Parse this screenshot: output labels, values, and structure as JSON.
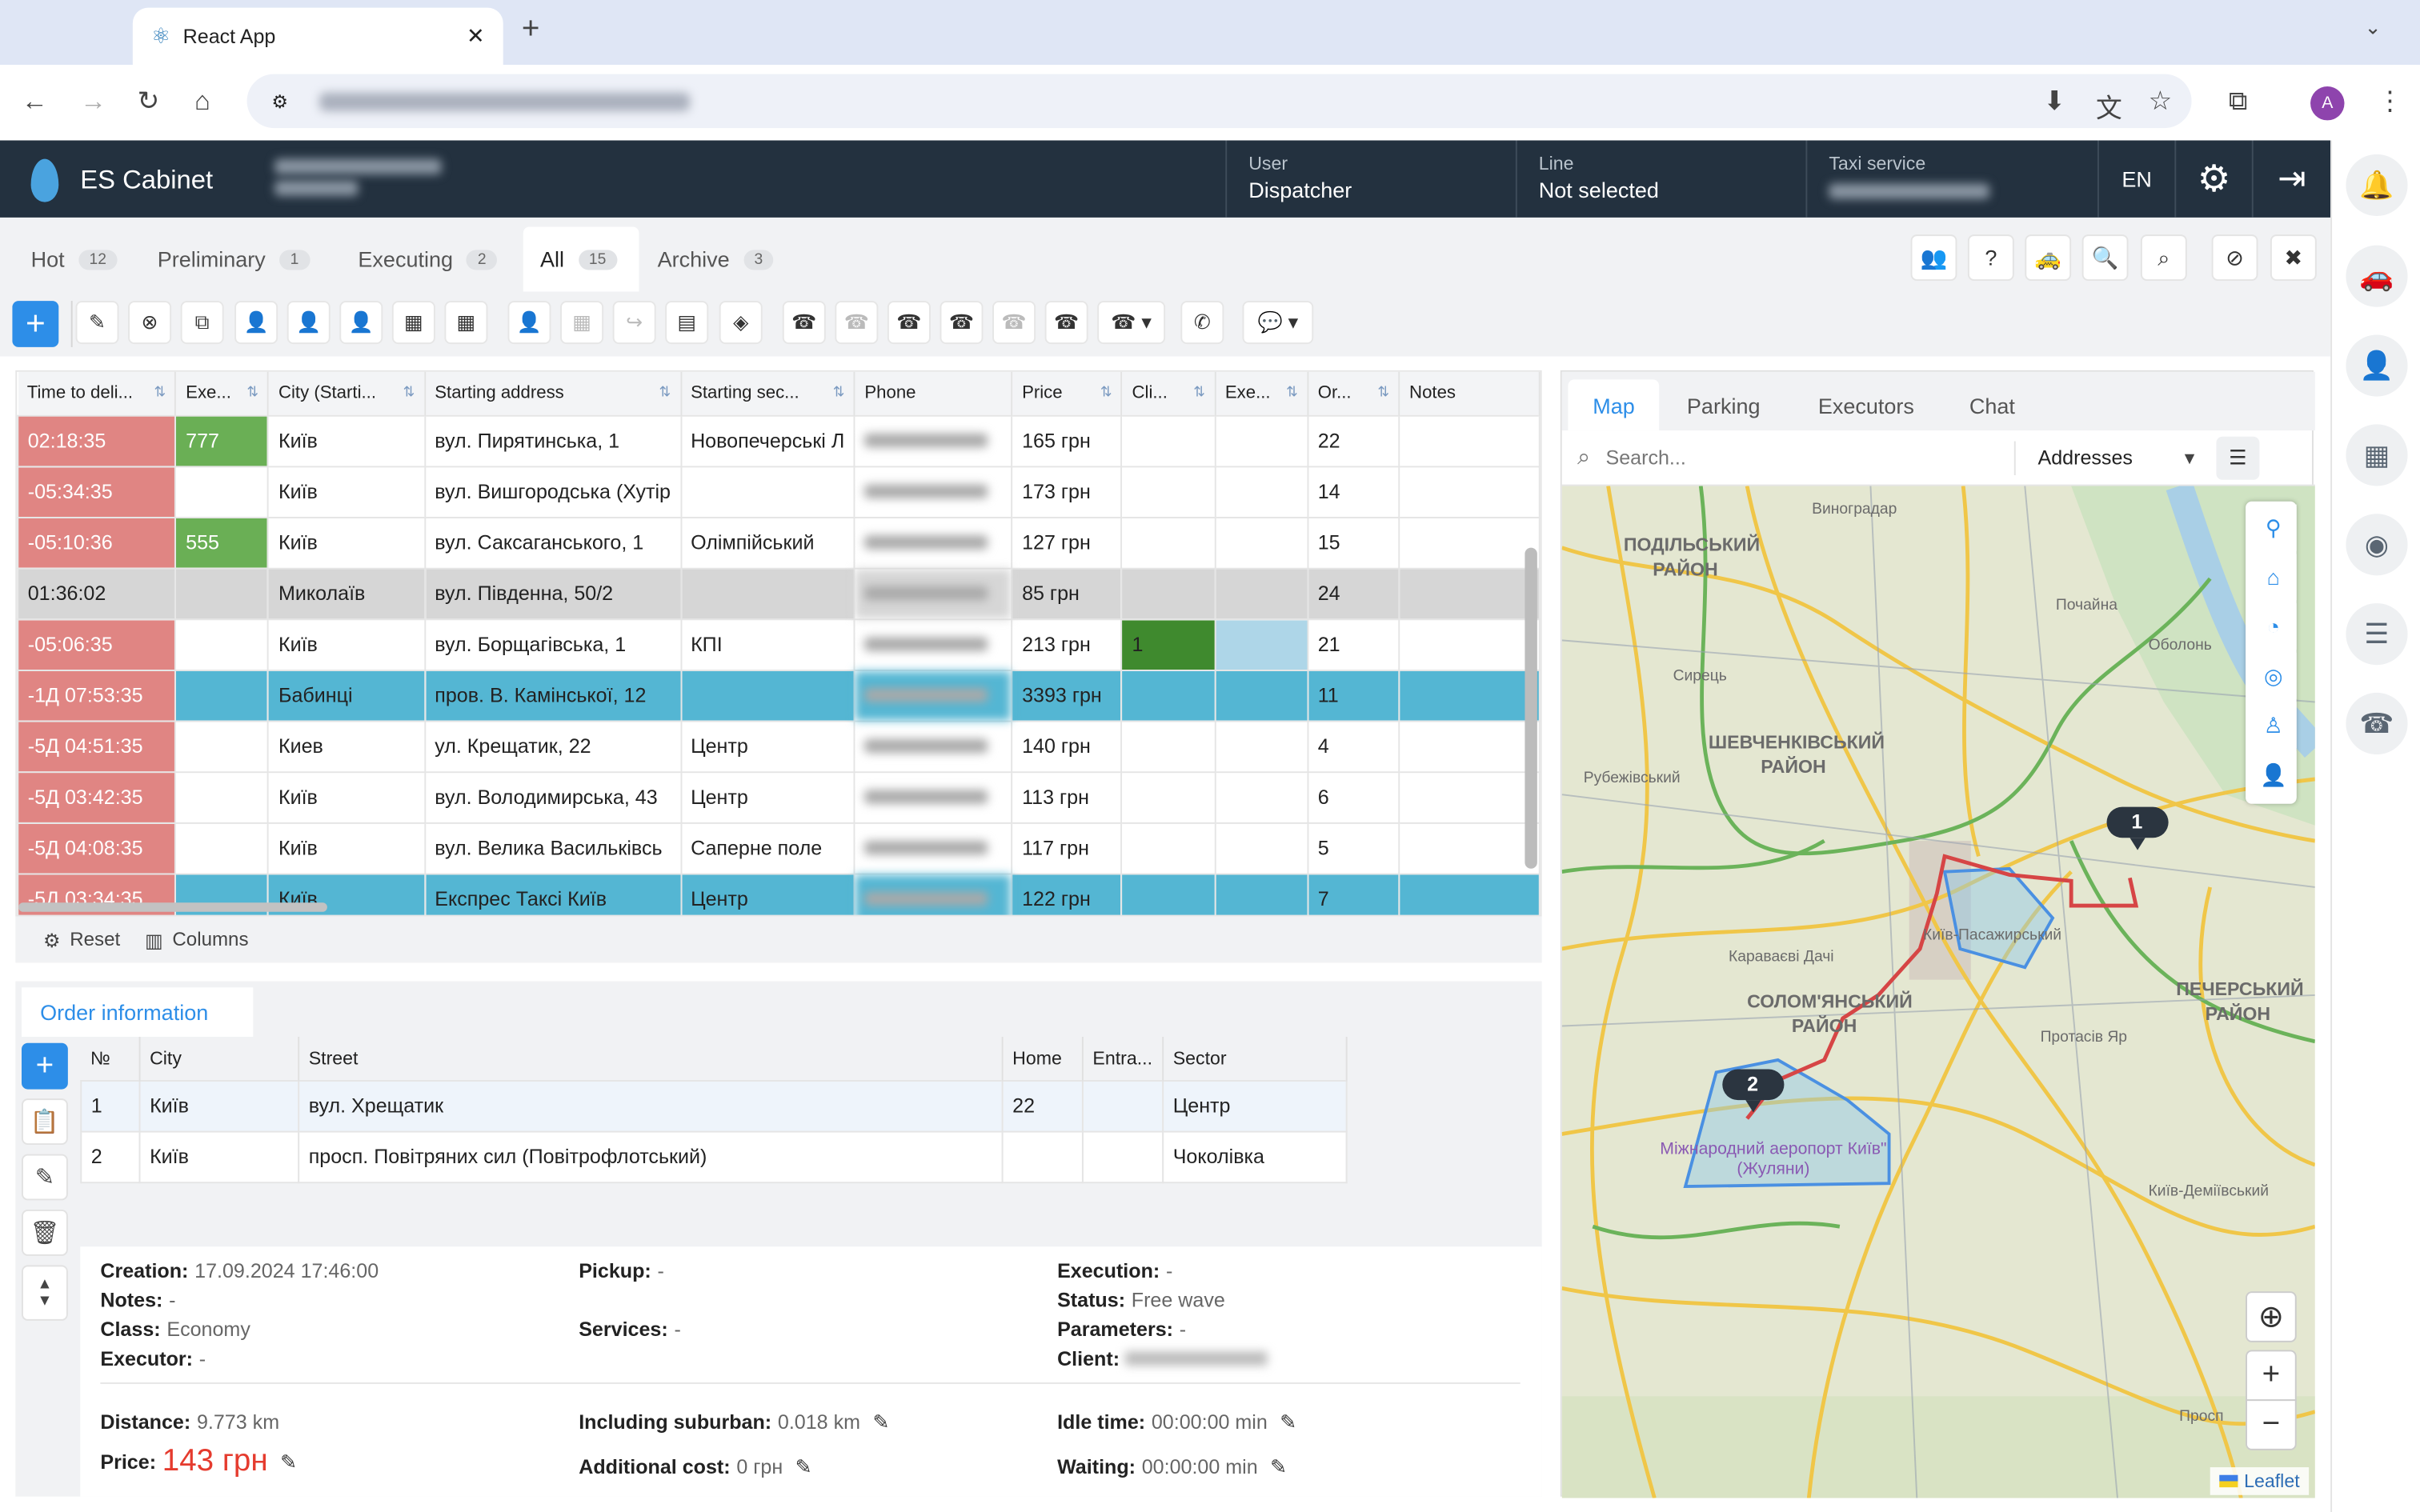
{
  "browser": {
    "tab_title": "React App",
    "new_tab": "+",
    "tab_menu": "⌄",
    "avatar": "A"
  },
  "app": {
    "brand": "ES Cabinet",
    "user": {
      "label": "User",
      "value": "Dispatcher"
    },
    "line": {
      "label": "Line",
      "value": "Not selected"
    },
    "taxi": {
      "label": "Taxi service"
    },
    "lang": "EN"
  },
  "tabs": [
    {
      "label": "Hot",
      "count": "12"
    },
    {
      "label": "Preliminary",
      "count": "1"
    },
    {
      "label": "Executing",
      "count": "2"
    },
    {
      "label": "All",
      "count": "15"
    },
    {
      "label": "Archive",
      "count": "3"
    }
  ],
  "table": {
    "headers": [
      "Time to deli...",
      "Exe...",
      "City (Starti...",
      "Starting address",
      "Starting sec...",
      "Phone",
      "Price",
      "Cli...",
      "Exe...",
      "Or...",
      "Notes"
    ],
    "rows": [
      {
        "time": "02:18:35",
        "exe": "777",
        "city": "Київ",
        "addr": "вул. Пирятинська, 1",
        "sector": "Новопечерські Л",
        "price": "165 грн",
        "cli": "",
        "exe2": "",
        "order": "22",
        "style": ""
      },
      {
        "time": "-05:34:35",
        "exe": "",
        "city": "Київ",
        "addr": "вул. Вишгородська (Хутір",
        "sector": "",
        "price": "173 грн",
        "cli": "",
        "exe2": "",
        "order": "14",
        "style": ""
      },
      {
        "time": "-05:10:36",
        "exe": "555",
        "city": "Київ",
        "addr": "вул. Саксаганського, 1",
        "sector": "Олімпійський",
        "price": "127 грн",
        "cli": "",
        "exe2": "",
        "order": "15",
        "style": ""
      },
      {
        "time": "01:36:02",
        "exe": "",
        "city": "Миколаїв",
        "addr": "вул. Південна, 50/2",
        "sector": "",
        "price": "85 грн",
        "cli": "",
        "exe2": "",
        "order": "24",
        "style": "gray"
      },
      {
        "time": "-05:06:35",
        "exe": "",
        "city": "Київ",
        "addr": "вул. Борщагівська, 1",
        "sector": "КПІ",
        "price": "213 грн",
        "cli": "1",
        "exe2": "",
        "order": "21",
        "style": ""
      },
      {
        "time": "-1Д 07:53:35",
        "exe": "",
        "city": "Бабинці",
        "addr": "пров. В. Камінської, 12",
        "sector": "",
        "price": "3393 грн",
        "cli": "",
        "exe2": "",
        "order": "11",
        "style": "blue"
      },
      {
        "time": "-5Д 04:51:35",
        "exe": "",
        "city": "Киев",
        "addr": "ул. Крещатик, 22",
        "sector": "Центр",
        "price": "140 грн",
        "cli": "",
        "exe2": "",
        "order": "4",
        "style": ""
      },
      {
        "time": "-5Д 03:42:35",
        "exe": "",
        "city": "Київ",
        "addr": "вул. Володимирська, 43",
        "sector": "Центр",
        "price": "113 грн",
        "cli": "",
        "exe2": "",
        "order": "6",
        "style": ""
      },
      {
        "time": "-5Д 04:08:35",
        "exe": "",
        "city": "Київ",
        "addr": "вул. Велика Васильківсь",
        "sector": "Саперне поле",
        "price": "117 грн",
        "cli": "",
        "exe2": "",
        "order": "5",
        "style": ""
      },
      {
        "time": "-5Д 03:34:35",
        "exe": "",
        "city": "Київ",
        "addr": "Експрес Таксі Київ",
        "sector": "Центр",
        "price": "122 грн",
        "cli": "",
        "exe2": "",
        "order": "7",
        "style": "blue"
      }
    ],
    "reset": "Reset",
    "columns": "Columns"
  },
  "order_info": {
    "tab": "Order information",
    "headers": [
      "№",
      "City",
      "Street",
      "Home",
      "Entra...",
      "Sector"
    ],
    "rows": [
      {
        "n": "1",
        "city": "Київ",
        "street": "вул. Хрещатик",
        "home": "22",
        "entr": "",
        "sector": "Центр"
      },
      {
        "n": "2",
        "city": "Київ",
        "street": "просп. Повітряних сил (Повітрофлотський)",
        "home": "",
        "entr": "",
        "sector": "Чоколівка"
      }
    ],
    "creation": {
      "k": "Creation:",
      "v": "17.09.2024 17:46:00"
    },
    "notes": {
      "k": "Notes:",
      "v": "-"
    },
    "class": {
      "k": "Class:",
      "v": "Economy"
    },
    "executor": {
      "k": "Executor:",
      "v": "-"
    },
    "pickup": {
      "k": "Pickup:",
      "v": "-"
    },
    "services": {
      "k": "Services:",
      "v": "-"
    },
    "execution": {
      "k": "Execution:",
      "v": "-"
    },
    "status": {
      "k": "Status:",
      "v": "Free wave"
    },
    "parameters": {
      "k": "Parameters:",
      "v": "-"
    },
    "client": {
      "k": "Client:"
    },
    "distance": {
      "k": "Distance:",
      "v": "9.773 km"
    },
    "suburban": {
      "k": "Including suburban:",
      "v": "0.018 km"
    },
    "idle": {
      "k": "Idle time:",
      "v": "00:00:00 min"
    },
    "price": {
      "k": "Price:",
      "v": "143 грн"
    },
    "additional": {
      "k": "Additional cost:",
      "v": "0 грн"
    },
    "waiting": {
      "k": "Waiting:",
      "v": "00:00:00 min"
    }
  },
  "map": {
    "tabs": [
      "Map",
      "Parking",
      "Executors",
      "Chat"
    ],
    "search_placeholder": "Search...",
    "addresses": "Addresses",
    "labels": [
      "ПОДІЛЬСЬКИЙ РАЙОН",
      "ШЕВЧЕНКІВСЬКИЙ РАЙОН",
      "СОЛОМ'ЯНСЬКИЙ РАЙОН",
      "ПЕЧЕРСЬКИЙ РАЙОН",
      "Виноградар",
      "Почайна",
      "Оболонь",
      "Сирець",
      "Рубежівський",
      "Караваєві Дачі",
      "Протасів Яр",
      "Київ-Пасажирський",
      "Київ-Деміївський",
      "Міжнародний аеропорт Київ\" (Жуляни)",
      "Просп"
    ],
    "marker1": "1",
    "marker2": "2",
    "attribution": "Leaflet",
    "zoom_in": "+",
    "zoom_out": "−"
  }
}
